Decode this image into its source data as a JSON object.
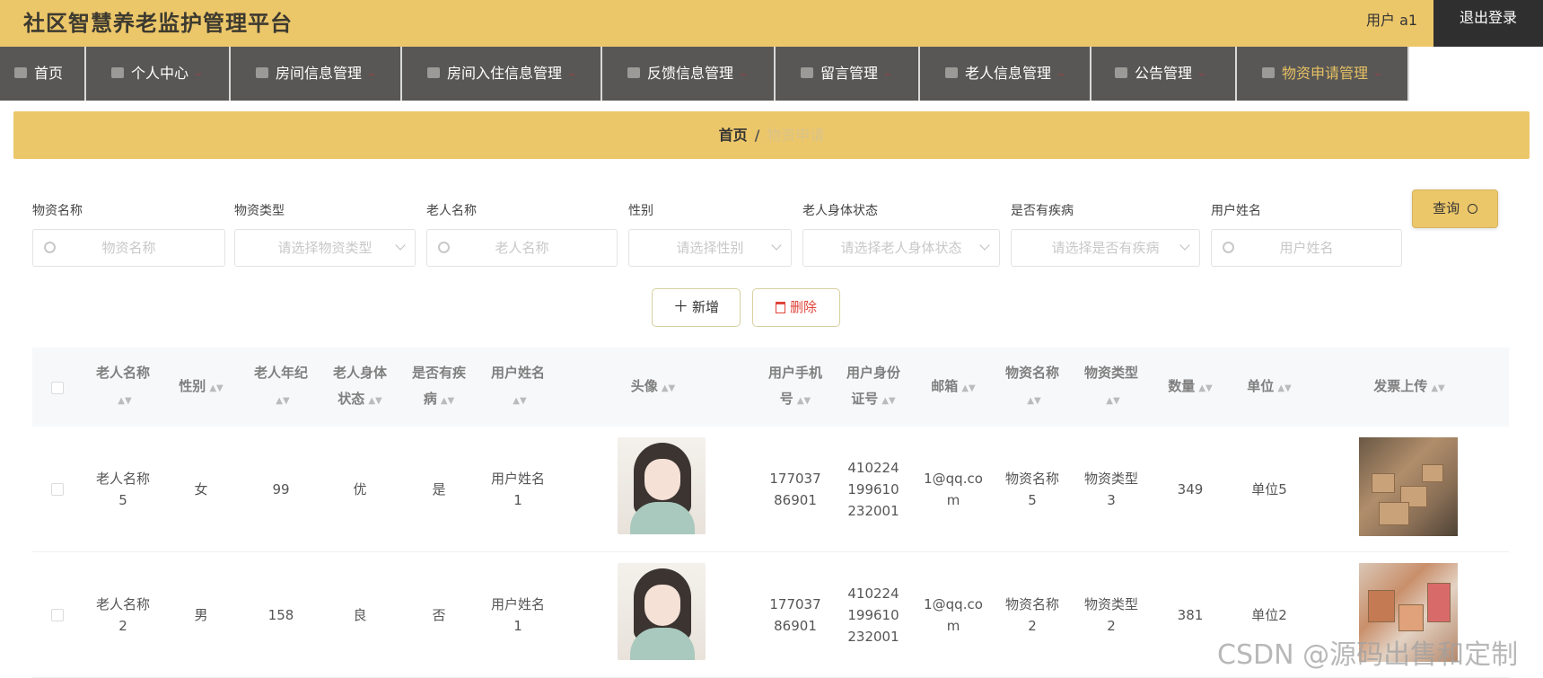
{
  "header": {
    "title": "社区智慧养老监护管理平台",
    "user": "用户 a1",
    "logout": "退出登录"
  },
  "nav": [
    {
      "label": "首页",
      "icon": "home-icon"
    },
    {
      "label": "个人中心",
      "icon": "user-icon"
    },
    {
      "label": "房间信息管理",
      "icon": "briefcase-icon"
    },
    {
      "label": "房间入住信息管理",
      "icon": "monitor-icon"
    },
    {
      "label": "反馈信息管理",
      "icon": "clipboard-icon"
    },
    {
      "label": "留言管理",
      "icon": "document-icon"
    },
    {
      "label": "老人信息管理",
      "icon": "monitor-icon"
    },
    {
      "label": "公告管理",
      "icon": "mail-icon"
    },
    {
      "label": "物资申请管理",
      "icon": "document-icon"
    }
  ],
  "breadcrumb": {
    "home": "首页",
    "sep": "/",
    "current": "物资申请"
  },
  "filters": [
    {
      "label": "物资名称",
      "placeholder": "物资名称",
      "kind": "search"
    },
    {
      "label": "物资类型",
      "placeholder": "请选择物资类型",
      "kind": "select"
    },
    {
      "label": "老人名称",
      "placeholder": "老人名称",
      "kind": "search"
    },
    {
      "label": "性别",
      "placeholder": "请选择性别",
      "kind": "select"
    },
    {
      "label": "老人身体状态",
      "placeholder": "请选择老人身体状态",
      "kind": "select"
    },
    {
      "label": "是否有疾病",
      "placeholder": "请选择是否有疾病",
      "kind": "select"
    },
    {
      "label": "用户姓名",
      "placeholder": "用户姓名",
      "kind": "search"
    }
  ],
  "buttons": {
    "query": "查询",
    "add": "新增",
    "delete": "删除"
  },
  "table": {
    "columns": [
      "老人名称",
      "性别",
      "老人年纪",
      "老人身体状态",
      "是否有疾病",
      "用户姓名",
      "头像",
      "用户手机号",
      "用户身份证号",
      "邮箱",
      "物资名称",
      "物资类型",
      "数量",
      "单位",
      "发票上传"
    ],
    "rows": [
      {
        "name": "老人名称5",
        "gender": "女",
        "age": "99",
        "status": "优",
        "disease": "是",
        "user": "用户姓名1",
        "phone": "17703786901",
        "idcard": "410224199610232001",
        "email": "1@qq.com",
        "item": "物资名称5",
        "type": "物资类型3",
        "qty": "349",
        "unit": "单位5"
      },
      {
        "name": "老人名称2",
        "gender": "男",
        "age": "158",
        "status": "良",
        "disease": "否",
        "user": "用户姓名1",
        "phone": "17703786901",
        "idcard": "410224199610232001",
        "email": "1@qq.com",
        "item": "物资名称2",
        "type": "物资类型2",
        "qty": "381",
        "unit": "单位2"
      }
    ]
  },
  "watermark": "CSDN @源码出售和定制"
}
